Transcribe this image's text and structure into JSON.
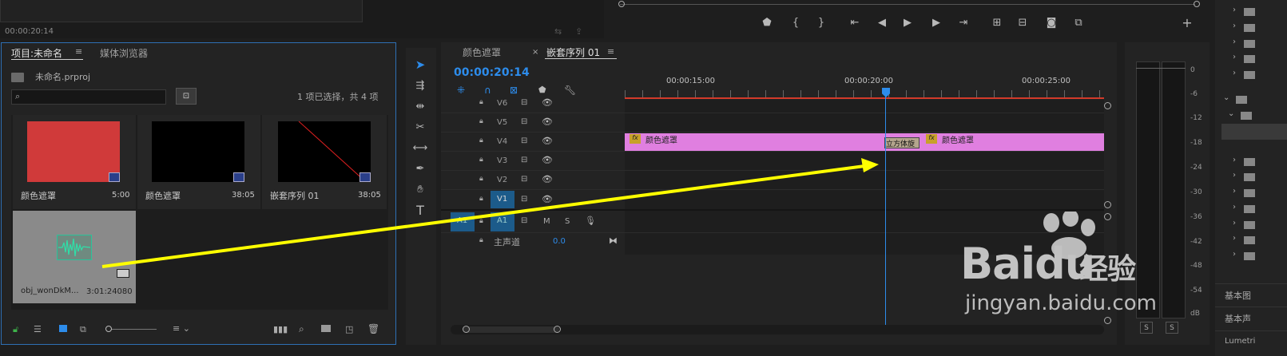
{
  "source_monitor": {
    "timecode": "00:00:20:14"
  },
  "project_panel": {
    "tab_active": "项目:未命名",
    "tab_media_browser": "媒体浏览器",
    "project_file": "未命名.prproj",
    "selection_status": "1 项已选择，共 4 项",
    "search_placeholder": "",
    "items": [
      {
        "name": "颜色遮罩",
        "duration": "5:00",
        "color": "#d03a3a"
      },
      {
        "name": "颜色遮罩",
        "duration": "38:05",
        "color": "#000000"
      },
      {
        "name": "嵌套序列 01",
        "duration": "38:05",
        "color": "#000000"
      },
      {
        "name": "obj_wonDkM...",
        "duration": "3:01:24080",
        "color": "#8a8a8a"
      }
    ]
  },
  "timeline": {
    "tab_color_matte": "颜色遮罩",
    "tab_nested": "嵌套序列 01",
    "playhead_timecode": "00:00:20:14",
    "ruler": [
      "00:00:15:00",
      "00:00:20:00",
      "00:00:25:00"
    ],
    "video_tracks": [
      "V6",
      "V5",
      "V4",
      "V3",
      "V2",
      "V1"
    ],
    "audio_track": "A1",
    "audio_source_patch": "A1",
    "audio_m": "M",
    "audio_s": "S",
    "master_label": "主声道",
    "master_value": "0.0",
    "clips": [
      {
        "fx": "fx",
        "name": "颜色遮罩"
      },
      {
        "fx": "fx",
        "name": "颜色遮罩"
      }
    ],
    "transition_label": "立方体旋"
  },
  "meter": {
    "scale": [
      "0",
      "-6",
      "-12",
      "-18",
      "-24",
      "-30",
      "-36",
      "-42",
      "-48",
      "-54",
      "dB"
    ],
    "solo_left": "S",
    "solo_right": "S"
  },
  "right_panel": {
    "label1": "基本图",
    "label2": "基本声",
    "label3": "Lumetri"
  },
  "watermark": {
    "brand": "Bai",
    "brand2": "du",
    "brand3": "经验",
    "url": "jingyan.baidu.com"
  },
  "colors": {
    "accent_blue": "#2d8ceb",
    "clip_pink": "#e07fe0",
    "arrow_yellow": "#ffff00",
    "in_out_red": "#d23a2a",
    "selected_track": "#1c5b8a"
  },
  "icons": [
    "selection-tool-icon",
    "track-select-tool-icon",
    "ripple-edit-tool-icon",
    "razor-tool-icon",
    "slip-tool-icon",
    "pen-tool-icon",
    "hand-tool-icon",
    "type-tool-icon",
    "lock-icon",
    "eye-icon",
    "film-icon",
    "mic-icon",
    "wrench-icon",
    "magnet-icon",
    "marker-icon",
    "play-icon",
    "step-back-icon",
    "step-forward-icon",
    "camera-icon",
    "plus-icon",
    "search-icon",
    "folder-icon",
    "trash-icon"
  ]
}
